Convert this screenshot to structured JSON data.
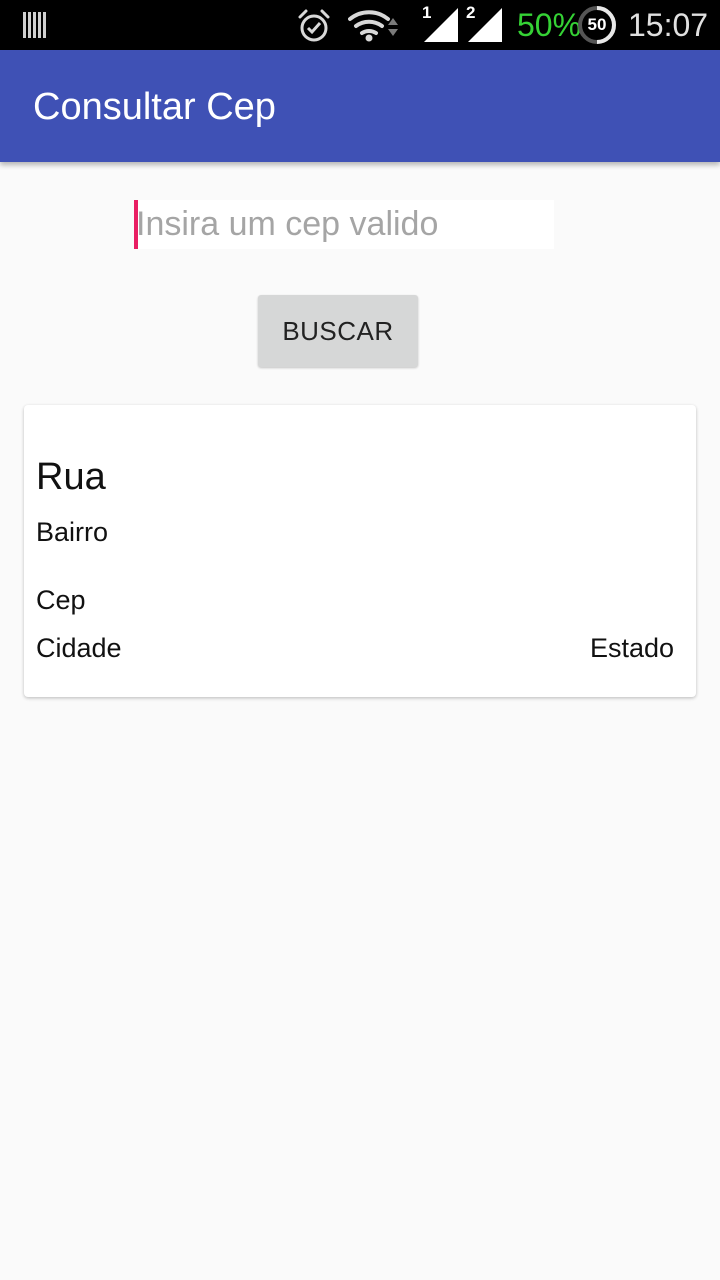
{
  "status_bar": {
    "icons": {
      "notification": "notification-bars-icon",
      "alarm": "alarm-icon",
      "wifi": "wifi-icon",
      "sim1": "signal-sim1-icon",
      "sim2": "signal-sim2-icon",
      "battery": "battery-circle-icon"
    },
    "sim1_label": "1",
    "sim2_label": "2",
    "battery_percent": "50%",
    "battery_circle_value": "50",
    "time": "15:07",
    "colors": {
      "battery_text": "#35d235",
      "background": "#000000"
    }
  },
  "app_bar": {
    "title": "Consultar Cep",
    "color": "#3f51b5"
  },
  "form": {
    "cep_input": {
      "value": "",
      "placeholder": "Insira um cep valido"
    },
    "search_button_label": "BUSCAR"
  },
  "result_card": {
    "street": "Rua",
    "neighborhood": "Bairro",
    "zipcode": "Cep",
    "city": "Cidade",
    "state": "Estado"
  },
  "colors": {
    "accent": "#e91e63",
    "primary": "#3f51b5",
    "button_background": "#d6d7d7"
  }
}
